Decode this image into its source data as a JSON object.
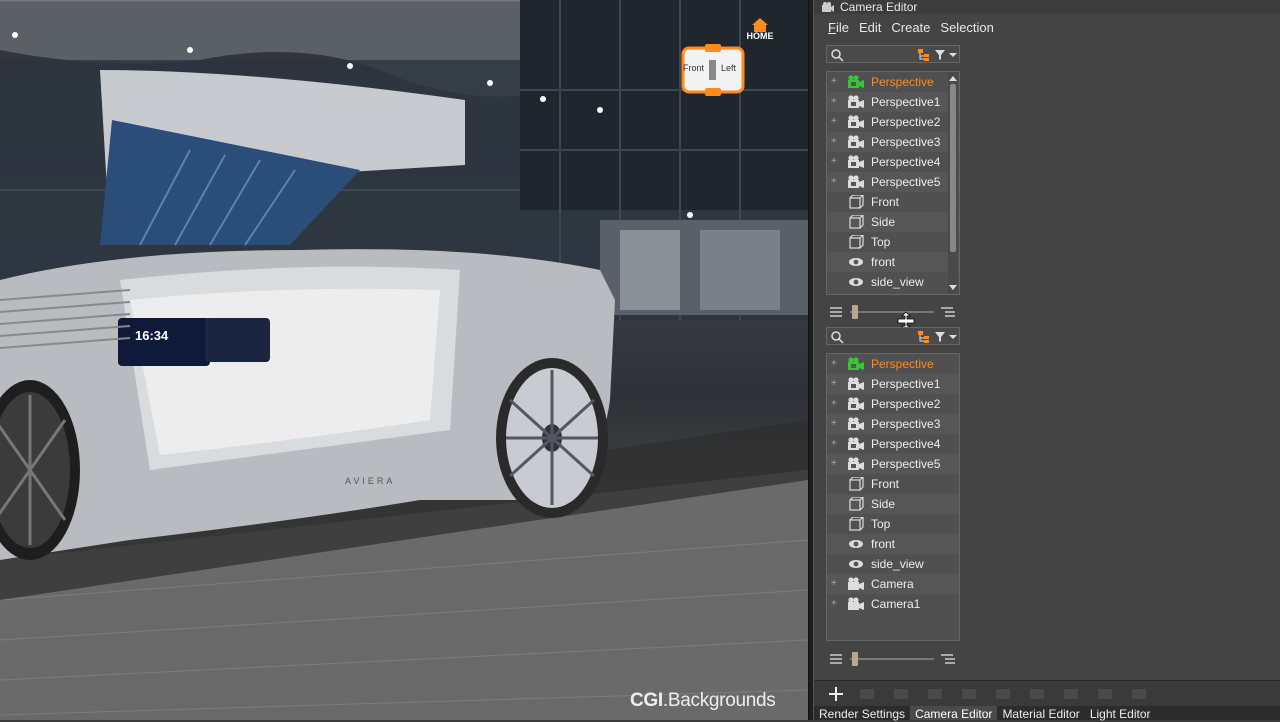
{
  "viewport": {
    "home_label": "HOME",
    "view_cube": {
      "front_label": "Front",
      "left_label": "Left"
    },
    "dashboard_time": "16:34",
    "watermark": {
      "bold": "CGI",
      "rest": ".Backgrounds"
    },
    "car_badge": "AVIERA"
  },
  "editor": {
    "title": "Camera Editor",
    "menu": [
      {
        "label": "File",
        "underline": "F",
        "rest": "ile"
      },
      {
        "label": "Edit"
      },
      {
        "label": "Create"
      },
      {
        "label": "Selection"
      }
    ],
    "upper_list": {
      "items": [
        {
          "label": "Perspective",
          "icon": "perspective-camera-icon",
          "selected": true,
          "expandable": true
        },
        {
          "label": "Perspective1",
          "icon": "perspective-camera-icon",
          "expandable": true
        },
        {
          "label": "Perspective2",
          "icon": "perspective-camera-icon",
          "expandable": true
        },
        {
          "label": "Perspective3",
          "icon": "perspective-camera-icon",
          "expandable": true
        },
        {
          "label": "Perspective4",
          "icon": "perspective-camera-icon",
          "expandable": true
        },
        {
          "label": "Perspective5",
          "icon": "perspective-camera-icon",
          "expandable": true
        },
        {
          "label": "Front",
          "icon": "ortho-cube-icon",
          "expandable": false
        },
        {
          "label": "Side",
          "icon": "ortho-cube-icon",
          "expandable": false
        },
        {
          "label": "Top",
          "icon": "ortho-cube-icon",
          "expandable": false
        },
        {
          "label": "front",
          "icon": "eye-icon",
          "expandable": false
        },
        {
          "label": "side_view",
          "icon": "eye-icon",
          "expandable": false
        }
      ]
    },
    "lower_list": {
      "items": [
        {
          "label": "Perspective",
          "icon": "perspective-camera-icon",
          "selected": true,
          "expandable": true
        },
        {
          "label": "Perspective1",
          "icon": "perspective-camera-icon",
          "expandable": true
        },
        {
          "label": "Perspective2",
          "icon": "perspective-camera-icon",
          "expandable": true
        },
        {
          "label": "Perspective3",
          "icon": "perspective-camera-icon",
          "expandable": true
        },
        {
          "label": "Perspective4",
          "icon": "perspective-camera-icon",
          "expandable": true
        },
        {
          "label": "Perspective5",
          "icon": "perspective-camera-icon",
          "expandable": true
        },
        {
          "label": "Front",
          "icon": "ortho-cube-icon",
          "expandable": false
        },
        {
          "label": "Side",
          "icon": "ortho-cube-icon",
          "expandable": false
        },
        {
          "label": "Top",
          "icon": "ortho-cube-icon",
          "expandable": false
        },
        {
          "label": "front",
          "icon": "eye-icon",
          "expandable": false
        },
        {
          "label": "side_view",
          "icon": "eye-icon",
          "expandable": false
        },
        {
          "label": "Camera",
          "icon": "camera-icon",
          "expandable": true
        },
        {
          "label": "Camera1",
          "icon": "camera-icon",
          "expandable": true
        }
      ]
    },
    "tabs": [
      {
        "label": "Render Settings",
        "active": false
      },
      {
        "label": "Camera Editor",
        "active": true
      },
      {
        "label": "Material Editor",
        "active": false
      },
      {
        "label": "Light Editor",
        "active": false
      }
    ],
    "colors": {
      "selected_text": "#ff8a1f",
      "selected_icon": "#37c637",
      "panel_bg": "#444444"
    }
  }
}
